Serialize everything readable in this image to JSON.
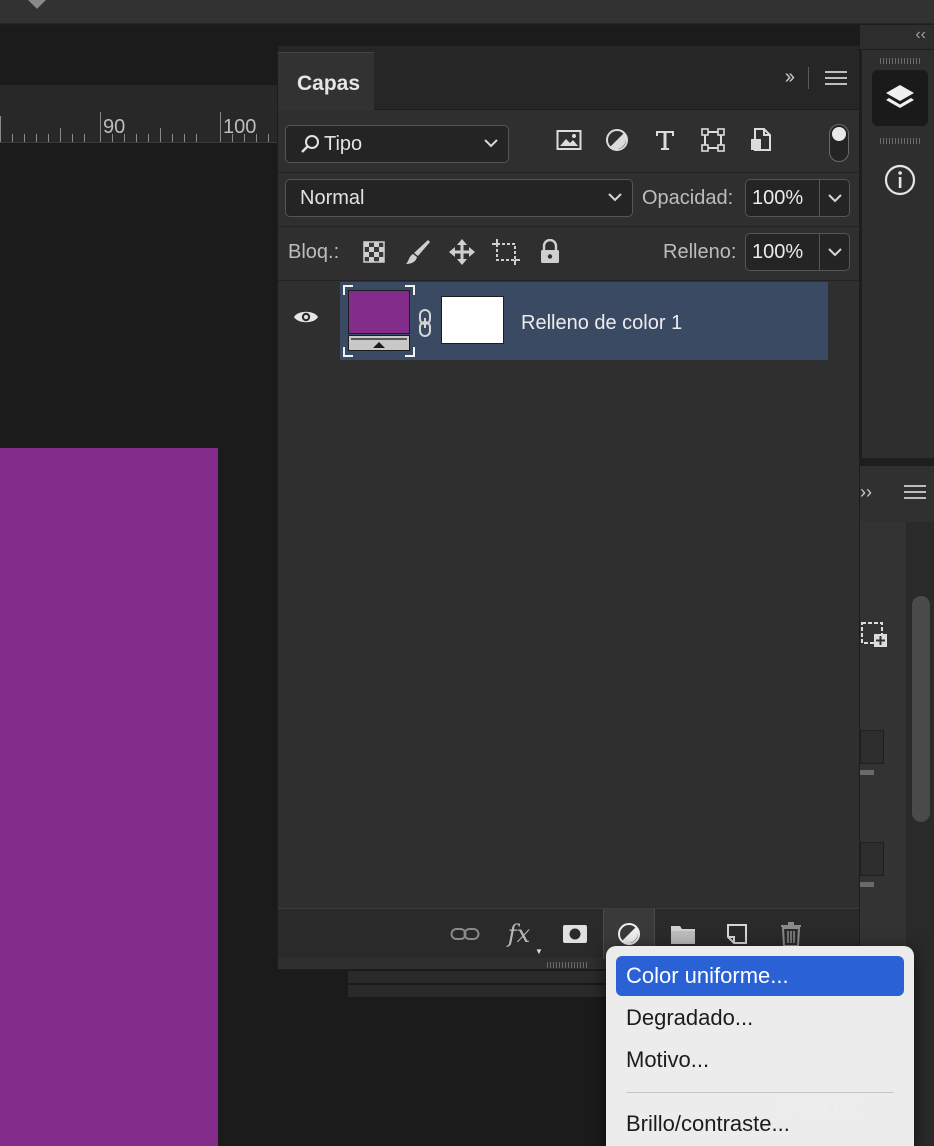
{
  "colors": {
    "accent": "#2a62d6",
    "document_fill": "#842c8b",
    "layer_selected": "#394a62",
    "layer_fill_thumb": "#842c8b"
  },
  "ruler": {
    "labels": [
      "90",
      "100"
    ]
  },
  "layers_panel": {
    "tab_label": "Capas",
    "filter": {
      "label": "Tipo",
      "icons": [
        "image-filter-icon",
        "adjustment-filter-icon",
        "type-filter-icon",
        "shape-filter-icon",
        "smart-object-filter-icon"
      ]
    },
    "blend_mode": "Normal",
    "opacity": {
      "label": "Opacidad:",
      "value": "100%"
    },
    "lock": {
      "label": "Bloq.:"
    },
    "fill": {
      "label": "Relleno:",
      "value": "100%"
    },
    "layers": [
      {
        "name": "Relleno de color 1",
        "visible": true,
        "selected": true
      }
    ],
    "bottom_icons": [
      "link-layers-icon",
      "fx-icon",
      "add-mask-icon",
      "adjustment-layer-icon",
      "folder-icon",
      "new-layer-icon",
      "trash-icon"
    ],
    "fx_label": "fx"
  },
  "adjustment_menu": {
    "items": [
      "Color uniforme...",
      "Degradado...",
      "Motivo...",
      "Brillo/contraste..."
    ],
    "highlighted_index": 0
  },
  "watermark": "Platz"
}
